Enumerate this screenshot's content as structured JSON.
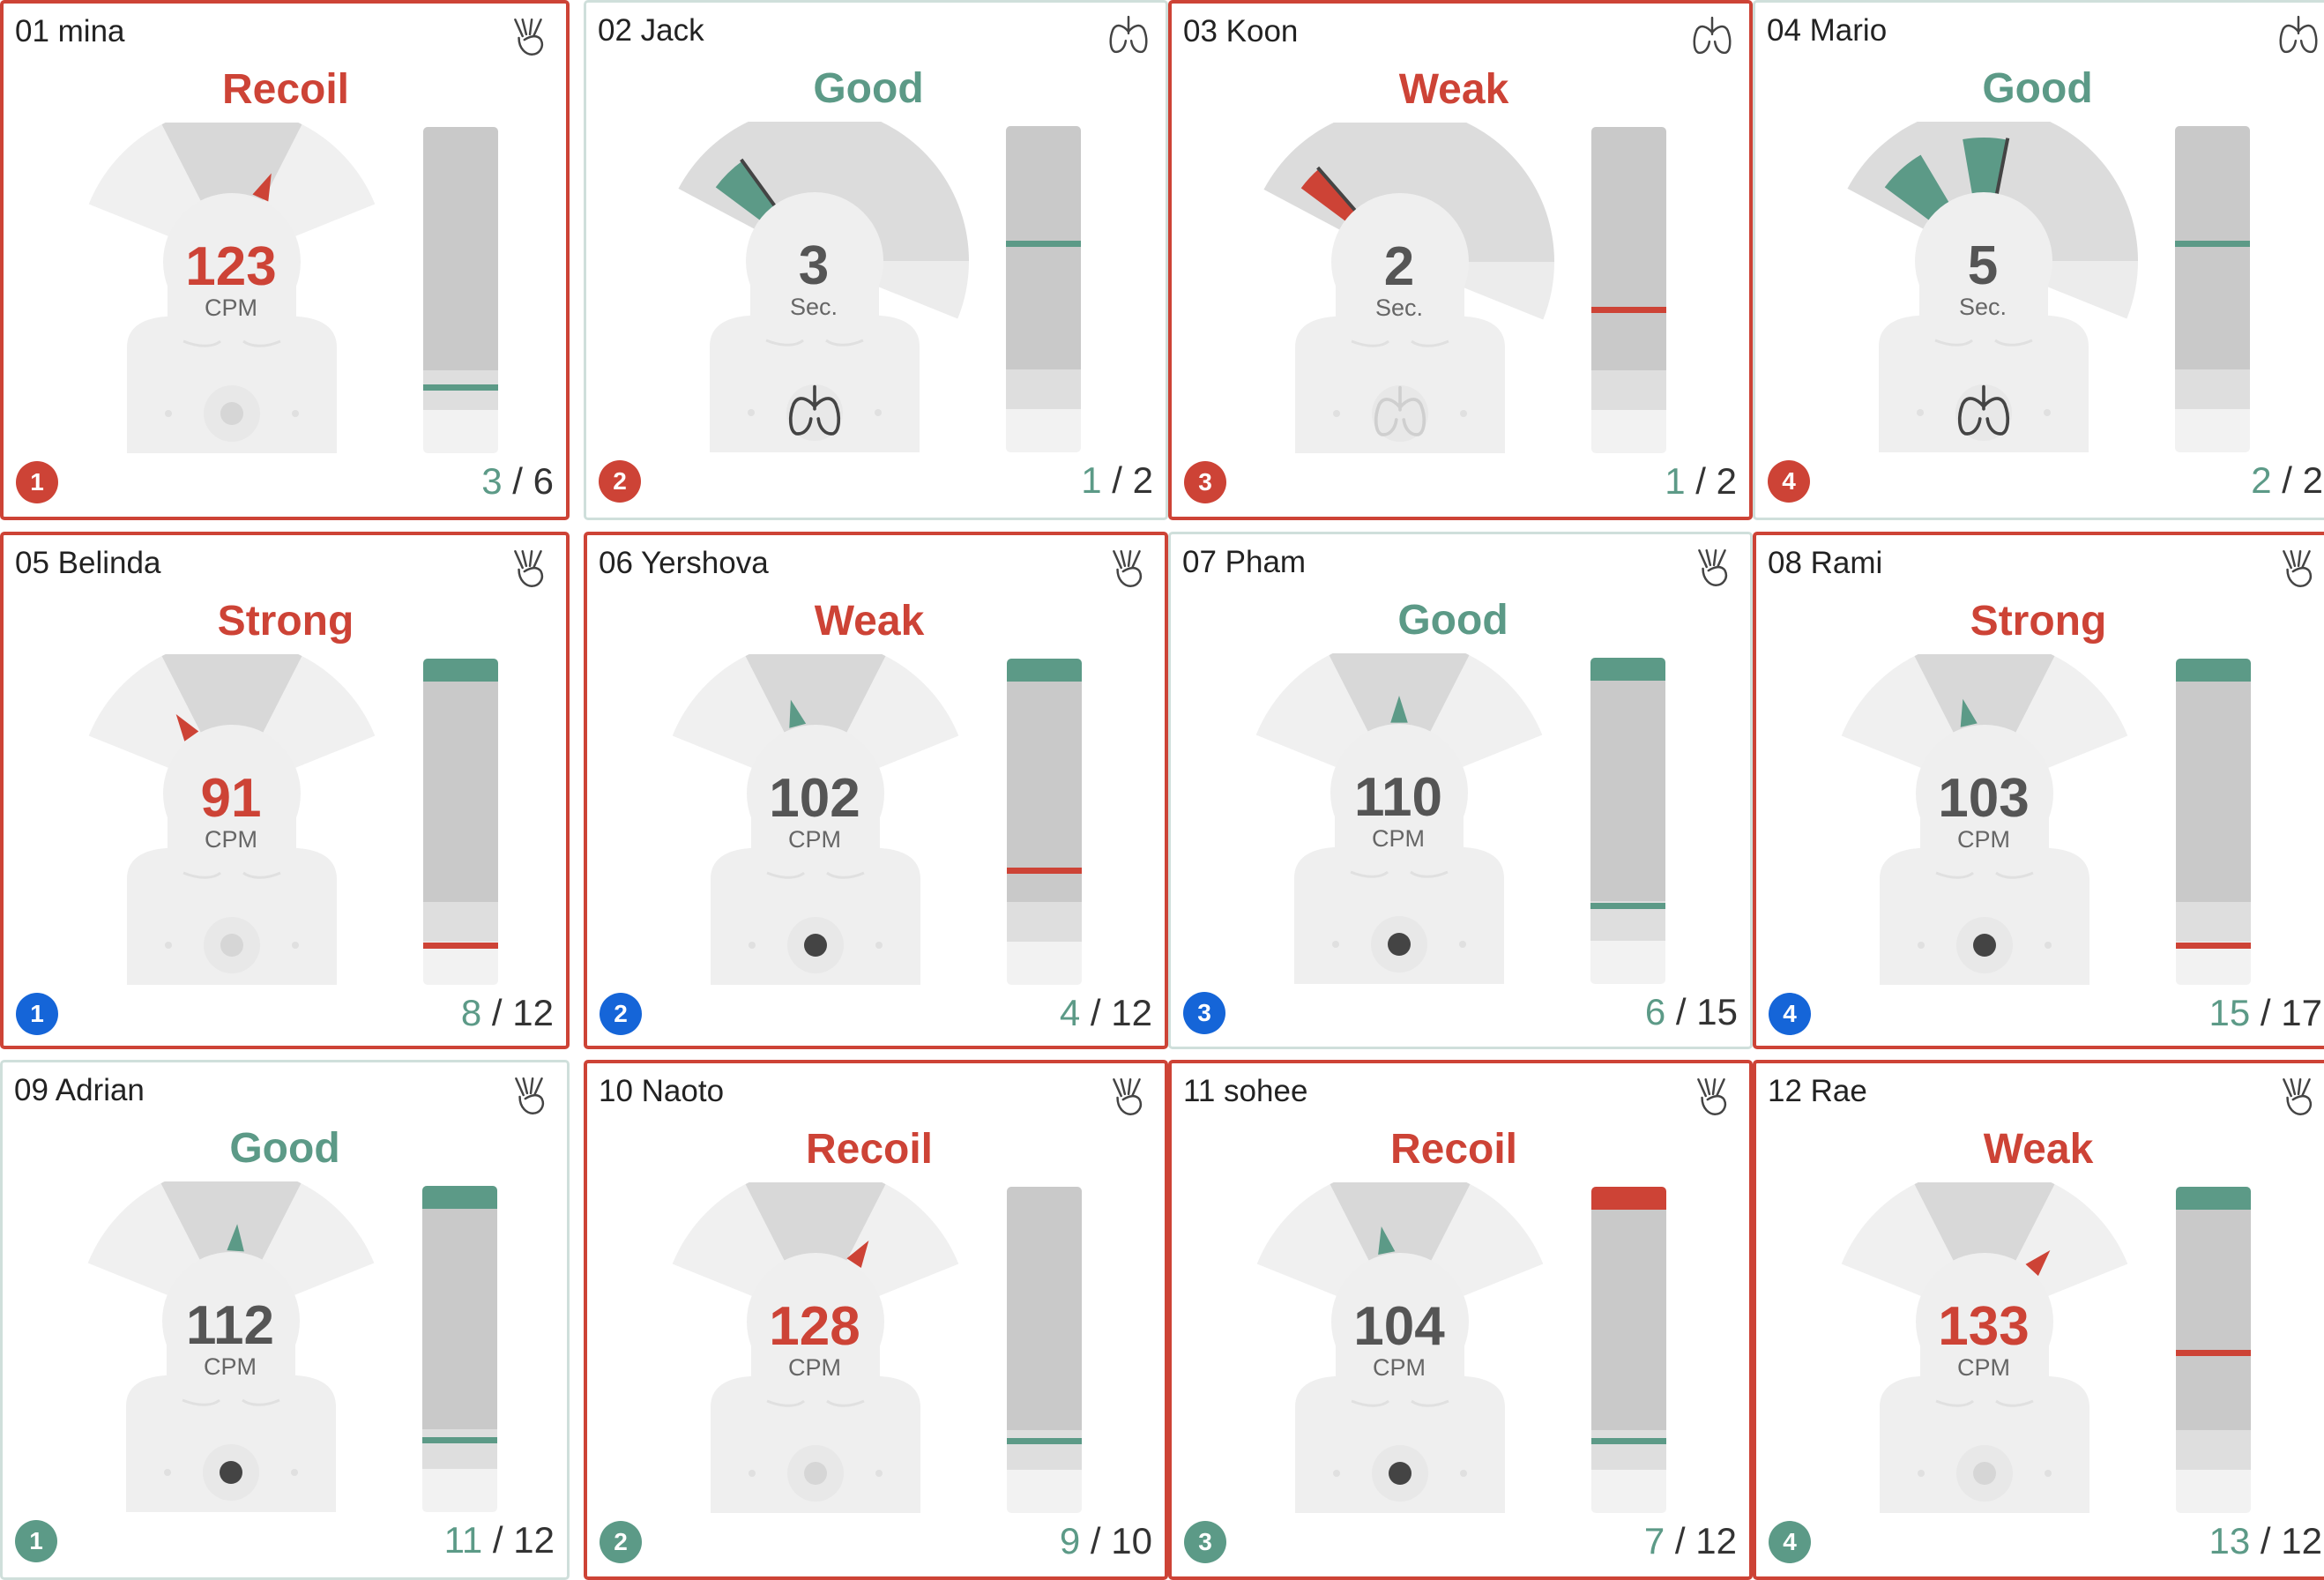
{
  "colors": {
    "good": "#5c9a87",
    "alert": "#cd4336",
    "neutral_text": "#555555",
    "badge_red": "#cd4336",
    "badge_blue": "#1565d8",
    "badge_green": "#5c9a87"
  },
  "cards": [
    {
      "name": "01 mina",
      "mode": "compression",
      "icon": "hands-compression-icon",
      "status": "Recoil",
      "status_tone": "alert",
      "alert": true,
      "value": "123",
      "unit": "CPM",
      "value_tone": "alert",
      "needle": 123,
      "needle_tone": "alert",
      "chest_dot": "light",
      "lung_icon": false,
      "lung_tone": "",
      "bar": {
        "top": "",
        "line_pos": 0.79,
        "line_tone": "good"
      },
      "badge": "1",
      "badge_color": "red",
      "done": "3",
      "total": "6"
    },
    {
      "name": "02 Jack",
      "mode": "ventilation",
      "icon": "lungs-icon",
      "status": "Good",
      "status_tone": "good",
      "alert": false,
      "value": "3",
      "unit": "Sec.",
      "value_tone": "neutral",
      "needle": null,
      "needle_tone": "",
      "arc_progress": 0.15,
      "arc_segments": [
        {
          "from": 0.05,
          "to": 0.15,
          "tone": "good"
        }
      ],
      "chest_dot": "none",
      "lung_icon": true,
      "lung_tone": "dark",
      "bar": {
        "top": "",
        "line_pos": 0.35,
        "line_tone": "good"
      },
      "badge": "2",
      "badge_color": "red",
      "done": "1",
      "total": "2"
    },
    {
      "name": "03 Koon",
      "mode": "ventilation",
      "icon": "lungs-icon",
      "status": "Weak",
      "status_tone": "alert",
      "alert": true,
      "value": "2",
      "unit": "Sec.",
      "value_tone": "neutral",
      "needle": null,
      "needle_tone": "",
      "arc_progress": 0.12,
      "arc_segments": [
        {
          "from": 0.05,
          "to": 0.12,
          "tone": "alert"
        }
      ],
      "chest_dot": "none",
      "lung_icon": true,
      "lung_tone": "light",
      "bar": {
        "top": "",
        "line_pos": 0.55,
        "line_tone": "alert"
      },
      "badge": "3",
      "badge_color": "red",
      "done": "1",
      "total": "2"
    },
    {
      "name": "04 Mario",
      "mode": "ventilation",
      "icon": "lungs-icon",
      "status": "Good",
      "status_tone": "good",
      "alert": false,
      "value": "5",
      "unit": "Sec.",
      "value_tone": "neutral",
      "needle": null,
      "needle_tone": "",
      "arc_progress": 0.42,
      "arc_segments": [
        {
          "from": 0.05,
          "to": 0.18,
          "tone": "good"
        },
        {
          "from": 0.3,
          "to": 0.42,
          "tone": "good"
        }
      ],
      "chest_dot": "none",
      "lung_icon": true,
      "lung_tone": "dark",
      "bar": {
        "top": "",
        "line_pos": 0.35,
        "line_tone": "good"
      },
      "badge": "4",
      "badge_color": "red",
      "done": "2",
      "total": "2"
    },
    {
      "name": "05 Belinda",
      "mode": "compression",
      "icon": "hands-compression-icon",
      "status": "Strong",
      "status_tone": "alert",
      "alert": true,
      "value": "91",
      "unit": "CPM",
      "value_tone": "alert",
      "needle": 91,
      "needle_tone": "alert",
      "chest_dot": "light",
      "lung_icon": false,
      "lung_tone": "",
      "bar": {
        "top": "good",
        "line_pos": 0.87,
        "line_tone": "alert"
      },
      "badge": "1",
      "badge_color": "blue",
      "done": "8",
      "total": "12"
    },
    {
      "name": "06 Yershova",
      "mode": "compression",
      "icon": "hands-compression-icon",
      "status": "Weak",
      "status_tone": "alert",
      "alert": true,
      "value": "102",
      "unit": "CPM",
      "value_tone": "neutral",
      "needle": 102,
      "needle_tone": "good",
      "chest_dot": "dark",
      "lung_icon": false,
      "lung_tone": "",
      "bar": {
        "top": "good",
        "line_pos": 0.64,
        "line_tone": "alert"
      },
      "badge": "2",
      "badge_color": "blue",
      "done": "4",
      "total": "12"
    },
    {
      "name": "07 Pham",
      "mode": "compression",
      "icon": "hands-compression-icon",
      "status": "Good",
      "status_tone": "good",
      "alert": false,
      "value": "110",
      "unit": "CPM",
      "value_tone": "neutral",
      "needle": 110,
      "needle_tone": "good",
      "chest_dot": "dark",
      "lung_icon": false,
      "lung_tone": "",
      "bar": {
        "top": "good",
        "line_pos": 0.75,
        "line_tone": "good"
      },
      "badge": "3",
      "badge_color": "blue",
      "done": "6",
      "total": "15"
    },
    {
      "name": "08 Rami",
      "mode": "compression",
      "icon": "hands-compression-icon",
      "status": "Strong",
      "status_tone": "alert",
      "alert": true,
      "value": "103",
      "unit": "CPM",
      "value_tone": "neutral",
      "needle": 103,
      "needle_tone": "good",
      "chest_dot": "dark",
      "lung_icon": false,
      "lung_tone": "",
      "bar": {
        "top": "good",
        "line_pos": 0.87,
        "line_tone": "alert"
      },
      "badge": "4",
      "badge_color": "blue",
      "done": "15",
      "total": "17"
    },
    {
      "name": "09 Adrian",
      "mode": "compression",
      "icon": "hands-compression-icon",
      "status": "Good",
      "status_tone": "good",
      "alert": false,
      "value": "112",
      "unit": "CPM",
      "value_tone": "neutral",
      "needle": 112,
      "needle_tone": "good",
      "chest_dot": "dark",
      "lung_icon": false,
      "lung_tone": "",
      "bar": {
        "top": "good",
        "line_pos": 0.77,
        "line_tone": "good"
      },
      "badge": "1",
      "badge_color": "green",
      "done": "11",
      "total": "12"
    },
    {
      "name": "10 Naoto",
      "mode": "compression",
      "icon": "hands-compression-icon",
      "status": "Recoil",
      "status_tone": "alert",
      "alert": true,
      "value": "128",
      "unit": "CPM",
      "value_tone": "alert",
      "needle": 128,
      "needle_tone": "alert",
      "chest_dot": "light",
      "lung_icon": false,
      "lung_tone": "",
      "bar": {
        "top": "",
        "line_pos": 0.77,
        "line_tone": "good"
      },
      "badge": "2",
      "badge_color": "green",
      "done": "9",
      "total": "10"
    },
    {
      "name": "11 sohee",
      "mode": "compression",
      "icon": "hands-compression-icon",
      "status": "Recoil",
      "status_tone": "alert",
      "alert": true,
      "value": "104",
      "unit": "CPM",
      "value_tone": "neutral",
      "needle": 104,
      "needle_tone": "good",
      "chest_dot": "dark",
      "lung_icon": false,
      "lung_tone": "",
      "bar": {
        "top": "alert",
        "line_pos": 0.77,
        "line_tone": "good"
      },
      "badge": "3",
      "badge_color": "green",
      "done": "7",
      "total": "12"
    },
    {
      "name": "12 Rae",
      "mode": "compression",
      "icon": "hands-compression-icon",
      "status": "Weak",
      "status_tone": "alert",
      "alert": true,
      "value": "133",
      "unit": "CPM",
      "value_tone": "alert",
      "needle": 133,
      "needle_tone": "alert",
      "chest_dot": "light",
      "lung_icon": false,
      "lung_tone": "",
      "bar": {
        "top": "good",
        "line_pos": 0.5,
        "line_tone": "alert"
      },
      "badge": "4",
      "badge_color": "green",
      "done": "13",
      "total": "12"
    }
  ]
}
